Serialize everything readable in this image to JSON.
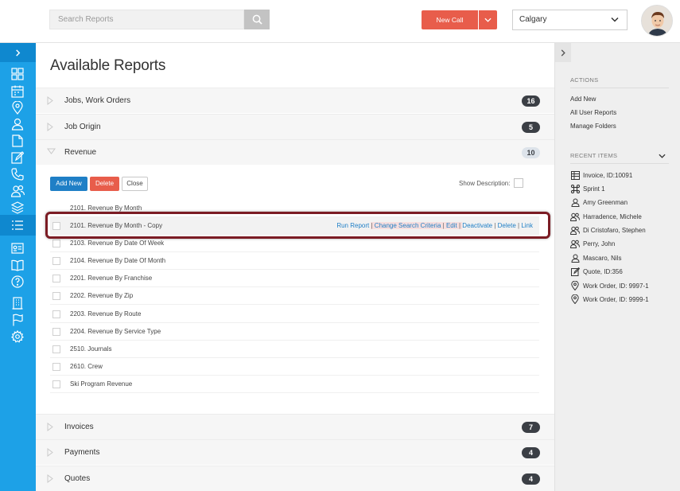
{
  "header": {
    "search_placeholder": "Search Reports",
    "new_call_label": "New Call",
    "city": "Calgary"
  },
  "page": {
    "title": "Available Reports"
  },
  "categories": [
    {
      "label": "Jobs, Work Orders",
      "count": "16"
    },
    {
      "label": "Job Origin",
      "count": "5"
    },
    {
      "label": "Revenue",
      "count": "10"
    },
    {
      "label": "Invoices",
      "count": "7"
    },
    {
      "label": "Payments",
      "count": "4"
    },
    {
      "label": "Quotes",
      "count": "4"
    }
  ],
  "revenue_panel": {
    "add_new": "Add New",
    "delete": "Delete",
    "close": "Close",
    "show_description": "Show Description:",
    "reports": [
      "2101. Revenue By Month",
      "2101. Revenue By Month - Copy",
      "2103. Revenue By Date Of Week",
      "2104. Revenue By Date Of Month",
      "2201. Revenue By Franchise",
      "2202. Revenue By Zip",
      "2203. Revenue By Route",
      "2204. Revenue By Service Type",
      "2510. Journals",
      "2610. Crew",
      "Ski Program Revenue"
    ],
    "row_actions": {
      "run_report": "Run Report",
      "change_search_criteria": "Change Search Criteria",
      "edit": "Edit",
      "deactivate": "Deactivate",
      "delete": "Delete",
      "link": "Link",
      "separator": "|"
    }
  },
  "right_panel": {
    "actions_heading": "ACTIONS",
    "actions": [
      "Add New",
      "All User Reports",
      "Manage Folders"
    ],
    "recent_heading": "RECENT ITEMS",
    "recent": [
      {
        "icon": "invoice-icon",
        "label": "Invoice, ID:10091"
      },
      {
        "icon": "sprint-icon",
        "label": "Sprint 1"
      },
      {
        "icon": "person-icon",
        "label": "Amy Greenman"
      },
      {
        "icon": "people-icon",
        "label": "Harradence, Michele"
      },
      {
        "icon": "people-icon",
        "label": "Di Cristofaro, Stephen"
      },
      {
        "icon": "people-icon",
        "label": "Perry, John"
      },
      {
        "icon": "person-icon",
        "label": "Mascaro, Nils"
      },
      {
        "icon": "quote-icon",
        "label": "Quote, ID:356"
      },
      {
        "icon": "location-pin-icon",
        "label": "Work Order, ID: 9997-1"
      },
      {
        "icon": "location-pin-icon",
        "label": "Work Order, ID: 9999-1"
      }
    ]
  },
  "colors": {
    "nav_blue": "#1da1e7",
    "nav_selected": "#0f88cf",
    "accent_red": "#e85d4b",
    "link_blue": "#1f7fc6",
    "badge_dark": "#3b3f45",
    "highlight_frame": "#7b1c24"
  }
}
